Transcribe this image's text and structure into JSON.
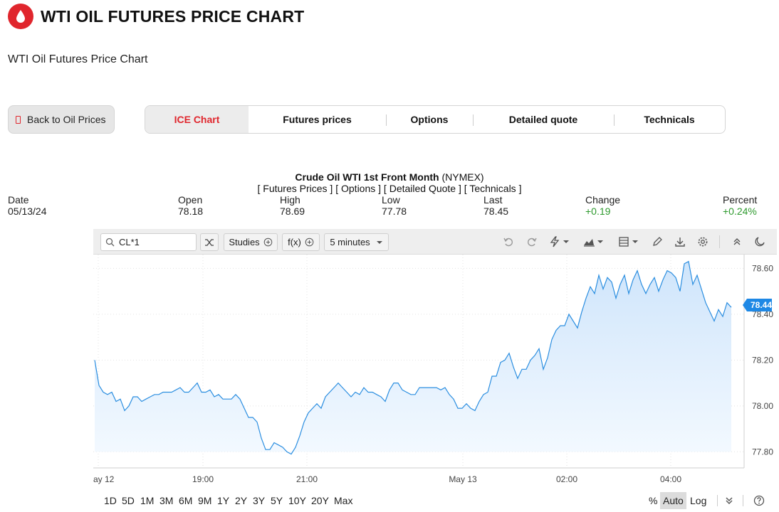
{
  "header": {
    "title": "WTI OIL FUTURES PRICE CHART",
    "subtitle": "WTI Oil Futures Price Chart"
  },
  "back_button": {
    "label": "Back to Oil Prices"
  },
  "tabs": [
    {
      "label": "ICE Chart",
      "active": true
    },
    {
      "label": "Futures prices"
    },
    {
      "label": "Options"
    },
    {
      "label": "Detailed quote"
    },
    {
      "label": "Technicals"
    }
  ],
  "instrument": {
    "name": "Crude Oil WTI 1st Front Month",
    "exchange": "(NYMEX)",
    "links": [
      "Futures Prices",
      "Options",
      "Detailed Quote",
      "Technicals"
    ]
  },
  "stats": [
    {
      "label": "Date",
      "value": "05/13/24"
    },
    {
      "label": "Open",
      "value": "78.18"
    },
    {
      "label": "High",
      "value": "78.69"
    },
    {
      "label": "Low",
      "value": "77.78"
    },
    {
      "label": "Last",
      "value": "78.45"
    },
    {
      "label": "Change",
      "value": "+0.19",
      "positive": true
    },
    {
      "label": "Percent",
      "value": "+0.24%",
      "positive": true
    }
  ],
  "toolbar": {
    "symbol": "CL*1",
    "studies_label": "Studies",
    "fx_label": "f(x)",
    "interval": "5 minutes"
  },
  "chart_data": {
    "type": "area",
    "xlabel": "",
    "ylabel": "",
    "ylim": [
      77.73,
      78.66
    ],
    "y_ticks": [
      "78.60",
      "78.40",
      "78.20",
      "78.00",
      "77.80"
    ],
    "x_ticks": [
      "ay 12",
      "19:00",
      "21:00",
      "May 13",
      "02:00",
      "04:00"
    ],
    "last_label": "78.44",
    "colors": {
      "line": "#2b8ee0",
      "fill_top": "#cfe5fb",
      "fill_bottom": "#f3f9ff",
      "last_badge": "#1e88e5"
    },
    "grid": true,
    "series": [
      {
        "values": [
          78.2,
          78.09,
          78.06,
          78.05,
          78.06,
          78.02,
          78.03,
          77.98,
          78.0,
          78.04,
          78.04,
          78.02,
          78.03,
          78.04,
          78.05,
          78.05,
          78.06,
          78.06,
          78.06,
          78.07,
          78.08,
          78.06,
          78.06,
          78.08,
          78.1,
          78.06,
          78.06,
          78.07,
          78.04,
          78.05,
          78.03,
          78.03,
          78.03,
          78.05,
          78.03,
          77.99,
          77.95,
          77.95,
          77.93,
          77.86,
          77.81,
          77.81,
          77.84,
          77.83,
          77.82,
          77.8,
          77.79,
          77.82,
          77.87,
          77.93,
          77.97,
          77.99,
          78.01,
          77.99,
          78.04,
          78.06,
          78.08,
          78.1,
          78.08,
          78.06,
          78.04,
          78.06,
          78.05,
          78.08,
          78.06,
          78.06,
          78.05,
          78.04,
          78.02,
          78.07,
          78.1,
          78.1,
          78.07,
          78.06,
          78.05,
          78.05,
          78.08,
          78.08,
          78.08,
          78.08,
          78.08,
          78.07,
          78.08,
          78.05,
          78.03,
          77.99,
          77.99,
          78.01,
          77.99,
          77.98,
          78.02,
          78.05,
          78.06,
          78.13,
          78.13,
          78.19,
          78.2,
          78.23,
          78.17,
          78.12,
          78.16,
          78.16,
          78.2,
          78.22,
          78.25,
          78.16,
          78.21,
          78.29,
          78.33,
          78.35,
          78.35,
          78.4,
          78.37,
          78.34,
          78.41,
          78.47,
          78.52,
          78.49,
          78.57,
          78.51,
          78.56,
          78.54,
          78.47,
          78.53,
          78.57,
          78.49,
          78.55,
          78.59,
          78.53,
          78.49,
          78.53,
          78.56,
          78.5,
          78.55,
          78.59,
          78.58,
          78.56,
          78.5,
          78.62,
          78.63,
          78.53,
          78.57,
          78.51,
          78.45,
          78.41,
          78.37,
          78.42,
          78.39,
          78.45,
          78.43
        ]
      }
    ]
  },
  "ranges": [
    "1D",
    "5D",
    "1M",
    "3M",
    "6M",
    "9M",
    "1Y",
    "2Y",
    "3Y",
    "5Y",
    "10Y",
    "20Y",
    "Max"
  ],
  "scale_options": {
    "percent": "%",
    "auto": "Auto",
    "log": "Log"
  }
}
